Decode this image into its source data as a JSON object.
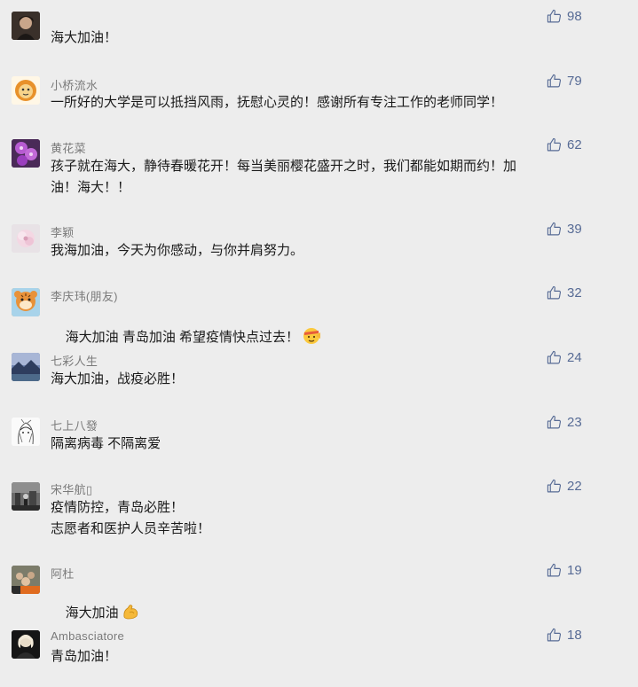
{
  "comments": [
    {
      "nickname": "",
      "content": "海大加油！",
      "likes": "98",
      "avatar": "dark-portrait"
    },
    {
      "nickname": "小桥流水",
      "content": "一所好的大学是可以抵挡风雨，抚慰心灵的！感谢所有专注工作的老师同学！",
      "likes": "79",
      "avatar": "lion-cartoon"
    },
    {
      "nickname": "黄花菜",
      "content": "孩子就在海大，静待春暖花开！每当美丽樱花盛开之时，我们都能如期而约！加\n油！海大！！",
      "likes": "62",
      "avatar": "purple-flower"
    },
    {
      "nickname": "李颖",
      "content": "我海加油，今天为你感动，与你并肩努力。",
      "likes": "39",
      "avatar": "pink-flower"
    },
    {
      "nickname": "李庆玮(朋友)",
      "content": "海大加油 青岛加油 希望疫情快点过去！",
      "likes": "32",
      "avatar": "tiger-cartoon",
      "emoji": "salute-face-emoji"
    },
    {
      "nickname": "七彩人生",
      "content": "海大加油，战疫必胜！",
      "likes": "24",
      "avatar": "landscape"
    },
    {
      "nickname": "七上八發",
      "content": "隔离病毒 不隔离爱",
      "likes": "23",
      "avatar": "anime-sketch"
    },
    {
      "nickname": "宋华航▯",
      "content": "疫情防控，青岛必胜！\n志愿者和医护人员辛苦啦！",
      "likes": "22",
      "avatar": "street-photo"
    },
    {
      "nickname": "阿杜",
      "content": "海大加油",
      "likes": "19",
      "avatar": "group-photo",
      "emoji": "flexed-biceps-emoji"
    },
    {
      "nickname": "Ambasciatore",
      "content": "青岛加油！",
      "likes": "18",
      "avatar": "portrait-dark"
    }
  ],
  "colors": {
    "background": "#ededed",
    "like": "#576b95",
    "nickname": "#7a7a7a",
    "content": "#1a1a1a"
  }
}
